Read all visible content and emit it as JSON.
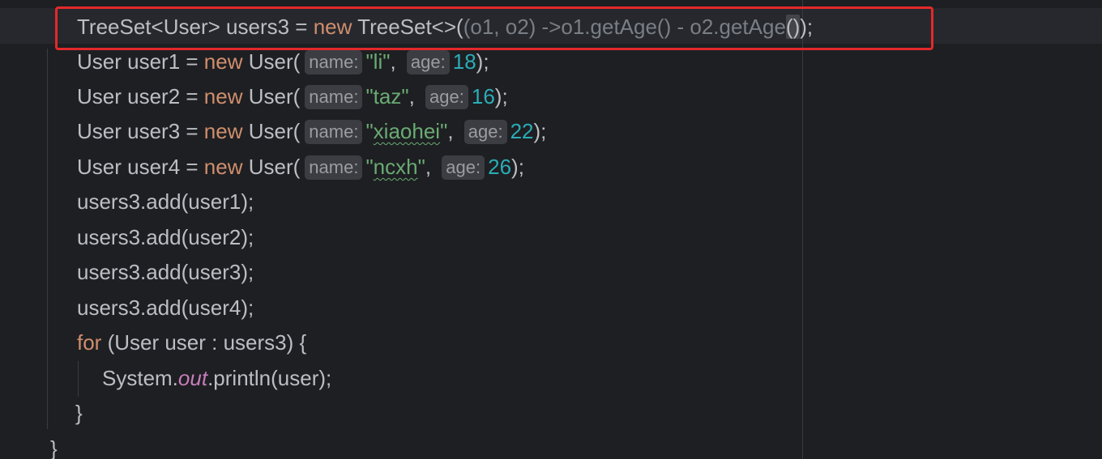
{
  "code": {
    "line1": {
      "type": "TreeSet<User>",
      "var": " users3 = ",
      "kw_new": "new",
      "ctor": " TreeSet<>(",
      "lambda": "(o1, o2) ->o1.getAge() - o2.getAge",
      "paren_hl": "()",
      "tail": ");"
    },
    "hint_name": "name:",
    "hint_age": "age:",
    "users": [
      {
        "decl": "User user1 = ",
        "ctor": " User(",
        "name": "\"li\"",
        "age": "18",
        "sq": false
      },
      {
        "decl": "User user2 = ",
        "ctor": " User(",
        "name": "\"taz\"",
        "age": "16",
        "sq": false
      },
      {
        "decl": "User user3 = ",
        "ctor": " User(",
        "open_q": "\"",
        "name_word": "xiaohei",
        "close_q": "\"",
        "age": "22",
        "sq": true
      },
      {
        "decl": "User user4 = ",
        "ctor": " User(",
        "open_q": "\"",
        "name_word": "ncxh",
        "close_q": "\"",
        "age": "26",
        "sq": true
      }
    ],
    "comma": ", ",
    "close": ");",
    "kw_new": "new",
    "adds": [
      "users3.add(user1);",
      "users3.add(user2);",
      "users3.add(user3);",
      "users3.add(user4);"
    ],
    "for_kw": "for",
    "for_rest": " (User user : users3) {",
    "println_prefix": "System.",
    "println_static": "out",
    "println_rest": ".println(user);",
    "close_for": "}",
    "close_method": "}"
  }
}
